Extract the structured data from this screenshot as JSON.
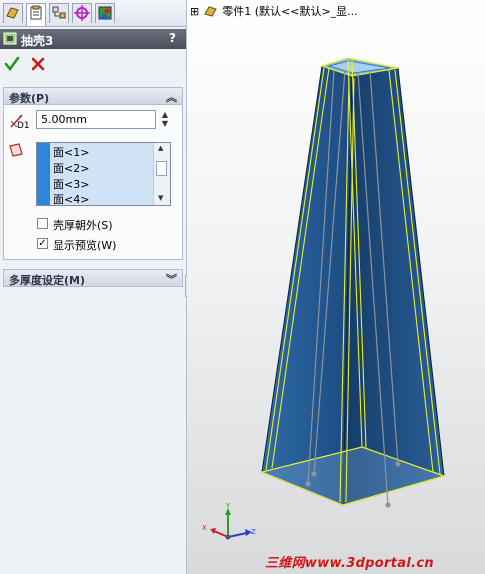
{
  "feature_manager": {
    "tabs": [
      {
        "name": "featuremanager-tab",
        "active": false
      },
      {
        "name": "propertymanager-tab",
        "active": true
      },
      {
        "name": "configurationmanager-tab",
        "active": false
      },
      {
        "name": "dimxpert-tab",
        "active": false
      },
      {
        "name": "display-manager-tab",
        "active": false
      }
    ]
  },
  "property_manager": {
    "title": "抽壳3",
    "help": "?",
    "params_header": "参数(P)",
    "thickness_label": "D1",
    "thickness_value": "5.00mm",
    "faces": [
      "面<1>",
      "面<2>",
      "面<3>",
      "面<4>"
    ],
    "shell_outward": {
      "label": "壳厚朝外(S)",
      "checked": false
    },
    "show_preview": {
      "label": "显示预览(W)",
      "checked": true
    },
    "multi_thickness_header": "多厚度设定(M)"
  },
  "viewport": {
    "tree_expand": "⊞",
    "tree_text": "零件1  (默认<<默认>_显...",
    "triad": {
      "x": "X",
      "y": "Y",
      "z": "Z"
    },
    "watermark": "三维网www.3dportal.cn"
  },
  "colors": {
    "model_face": "#1e4f86",
    "preview_edge": "#e8ef2a",
    "title_bar": "#555a66",
    "watermark": "#d01818"
  }
}
